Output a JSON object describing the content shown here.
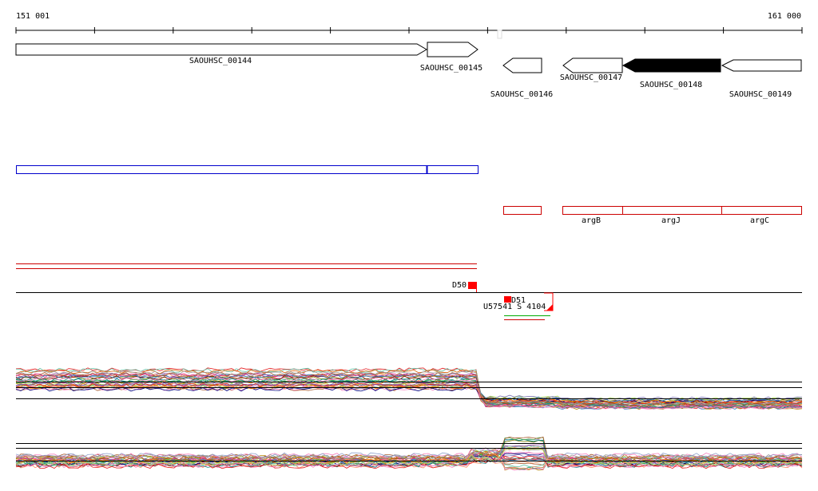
{
  "ruler": {
    "start_label": "151 001",
    "end_label": "161 000"
  },
  "genes": [
    {
      "id": "SAOUHSC_00144",
      "strand": "+",
      "highlighted": false
    },
    {
      "id": "SAOUHSC_00145",
      "strand": "+",
      "highlighted": false
    },
    {
      "id": "SAOUHSC_00146",
      "strand": "-",
      "highlighted": false
    },
    {
      "id": "SAOUHSC_00147",
      "strand": "-",
      "highlighted": false
    },
    {
      "id": "SAOUHSC_00148",
      "strand": "-",
      "highlighted": true
    },
    {
      "id": "SAOUHSC_00149",
      "strand": "-",
      "highlighted": false
    }
  ],
  "gene_names": [
    "argB",
    "argJ",
    "argC"
  ],
  "features": {
    "d50": "D50",
    "d51": "D51",
    "overlap": "U57541 S 4104"
  },
  "colors": {
    "operon_blue": "#0000cc",
    "gene_red": "#cc0000",
    "feature_red": "#ff0000",
    "green": "#00aa00"
  }
}
